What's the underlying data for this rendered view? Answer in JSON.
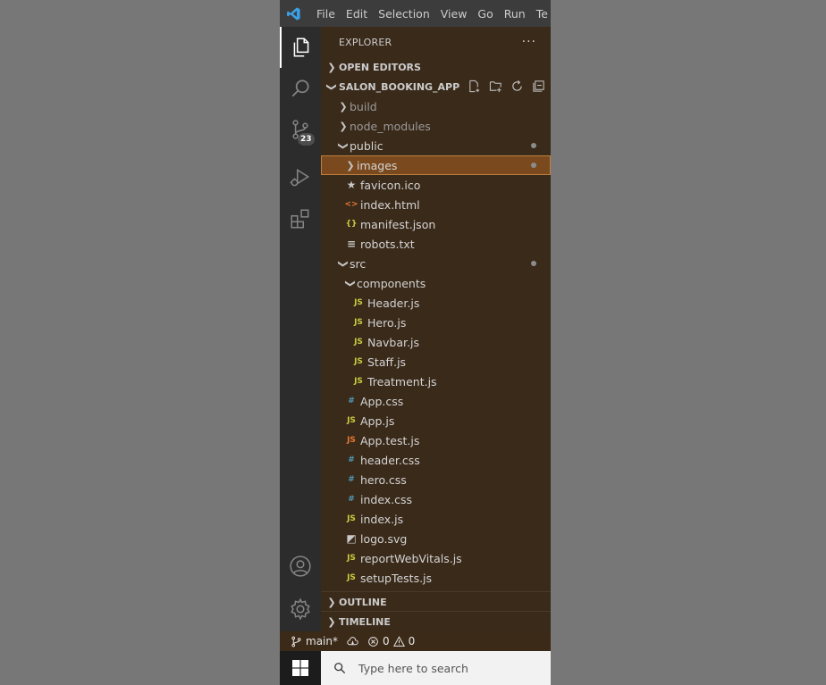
{
  "titlebar": {
    "menu": [
      "File",
      "Edit",
      "Selection",
      "View",
      "Go",
      "Run",
      "Te"
    ]
  },
  "activity": {
    "items": [
      "explorer-icon",
      "search-icon",
      "source-control-icon",
      "run-debug-icon",
      "extensions-icon"
    ],
    "source_control_badge": "23",
    "bottom": [
      "account-icon",
      "settings-gear-icon"
    ]
  },
  "sidebar": {
    "header": "EXPLORER",
    "more": "···",
    "open_editors": "OPEN EDITORS",
    "project": "SALON_BOOKING_APP",
    "outline": "OUTLINE",
    "timeline": "TIMELINE"
  },
  "tree": [
    {
      "label": "build",
      "depth": 0,
      "type": "folder",
      "open": false,
      "muted": true
    },
    {
      "label": "node_modules",
      "depth": 0,
      "type": "folder",
      "open": false,
      "muted": true
    },
    {
      "label": "public",
      "depth": 0,
      "type": "folder",
      "open": true,
      "dot": true
    },
    {
      "label": "images",
      "depth": 1,
      "type": "folder",
      "open": false,
      "dot": true,
      "selected": true
    },
    {
      "label": "favicon.ico",
      "depth": 1,
      "type": "file",
      "icon": "★",
      "iconColor": "#c9c9c9"
    },
    {
      "label": "index.html",
      "depth": 1,
      "type": "file",
      "icon": "<>",
      "iconColor": "#e37933"
    },
    {
      "label": "manifest.json",
      "depth": 1,
      "type": "file",
      "icon": "{}",
      "iconColor": "#cbcb41"
    },
    {
      "label": "robots.txt",
      "depth": 1,
      "type": "file",
      "icon": "≡",
      "iconColor": "#c9c9c9"
    },
    {
      "label": "src",
      "depth": 0,
      "type": "folder",
      "open": true,
      "dot": true
    },
    {
      "label": "components",
      "depth": 1,
      "type": "folder",
      "open": true
    },
    {
      "label": "Header.js",
      "depth": 2,
      "type": "file",
      "icon": "JS",
      "iconColor": "#cbcb41"
    },
    {
      "label": "Hero.js",
      "depth": 2,
      "type": "file",
      "icon": "JS",
      "iconColor": "#cbcb41"
    },
    {
      "label": "Navbar.js",
      "depth": 2,
      "type": "file",
      "icon": "JS",
      "iconColor": "#cbcb41"
    },
    {
      "label": "Staff.js",
      "depth": 2,
      "type": "file",
      "icon": "JS",
      "iconColor": "#cbcb41"
    },
    {
      "label": "Treatment.js",
      "depth": 2,
      "type": "file",
      "icon": "JS",
      "iconColor": "#cbcb41"
    },
    {
      "label": "App.css",
      "depth": 1,
      "type": "file",
      "icon": "#",
      "iconColor": "#519aba"
    },
    {
      "label": "App.js",
      "depth": 1,
      "type": "file",
      "icon": "JS",
      "iconColor": "#cbcb41"
    },
    {
      "label": "App.test.js",
      "depth": 1,
      "type": "file",
      "icon": "JS",
      "iconColor": "#e37933"
    },
    {
      "label": "header.css",
      "depth": 1,
      "type": "file",
      "icon": "#",
      "iconColor": "#519aba"
    },
    {
      "label": "hero.css",
      "depth": 1,
      "type": "file",
      "icon": "#",
      "iconColor": "#519aba"
    },
    {
      "label": "index.css",
      "depth": 1,
      "type": "file",
      "icon": "#",
      "iconColor": "#519aba"
    },
    {
      "label": "index.js",
      "depth": 1,
      "type": "file",
      "icon": "JS",
      "iconColor": "#cbcb41"
    },
    {
      "label": "logo.svg",
      "depth": 1,
      "type": "file",
      "icon": "◩",
      "iconColor": "#c9c9c9"
    },
    {
      "label": "reportWebVitals.js",
      "depth": 1,
      "type": "file",
      "icon": "JS",
      "iconColor": "#cbcb41"
    },
    {
      "label": "setupTests.js",
      "depth": 1,
      "type": "file",
      "icon": "JS",
      "iconColor": "#cbcb41"
    }
  ],
  "statusbar": {
    "branch": "main*",
    "errors": "0",
    "warnings": "0"
  },
  "taskbar": {
    "search_placeholder": "Type here to search"
  },
  "colors": {
    "sidebar_bg": "#3a2a1a",
    "selection": "#7a4a1e",
    "js_yellow": "#cbcb41",
    "css_blue": "#519aba"
  }
}
